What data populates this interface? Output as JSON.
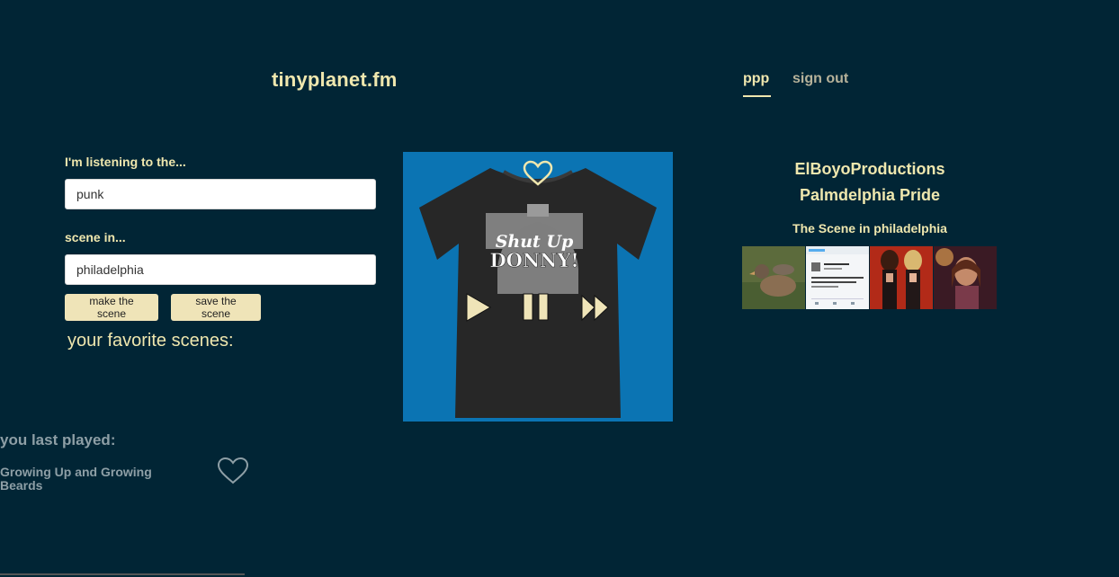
{
  "header": {
    "logo": "tinyplanet.fm",
    "nav": {
      "user": "ppp",
      "signout": "sign out"
    }
  },
  "form": {
    "genre_label": "I'm listening to the...",
    "genre_value": "punk",
    "city_label": "scene in...",
    "city_value": "philadelphia",
    "make_button": "make the scene",
    "save_button": "save the scene"
  },
  "favorites": {
    "title": "your favorite scenes:"
  },
  "last_played": {
    "title": "you last played:",
    "track": "Growing Up and Growing Beards"
  },
  "player": {
    "artwork_text": [
      "Shut Up",
      "DONNY!"
    ]
  },
  "artist": {
    "line1": "ElBoyoProductions",
    "line2": "Palmdelphia Pride",
    "scene": "The Scene in philadelphia"
  },
  "photos": [
    "duck photo",
    "tweet screenshot",
    "two women photo",
    "selfie photo"
  ],
  "colors": {
    "background": "#012535",
    "accent": "#efe7ae",
    "player_bg": "#0b74b3",
    "button": "#efe4b8"
  }
}
